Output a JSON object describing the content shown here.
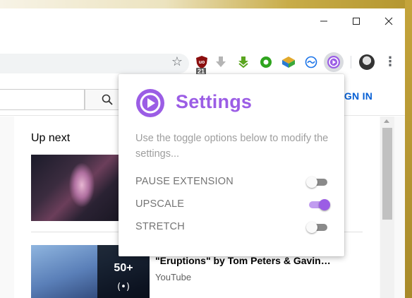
{
  "theme": {
    "accent": "#9b5de5",
    "accent_light": "#c19cf0",
    "link_blue": "#065fd4"
  },
  "window_controls": {
    "minimize_icon": "minimize-icon",
    "maximize_icon": "maximize-icon",
    "close_icon": "close-icon"
  },
  "toolbar": {
    "extensions": [
      {
        "icon": "ublock-icon",
        "badge": "21"
      },
      {
        "icon": "download-gray-icon"
      },
      {
        "icon": "download-green-icon"
      },
      {
        "icon": "green-circle-icon"
      },
      {
        "icon": "cube-icon"
      },
      {
        "icon": "sync-icon"
      },
      {
        "icon": "play-extension-icon"
      }
    ],
    "bookmark_icon": "star-icon",
    "menu_icon": "more-vert-icon"
  },
  "youtube": {
    "sign_in_label": "SIGN IN",
    "up_next_label": "Up next",
    "videos": [
      {
        "thumbnail": "anime-night-thumbnail"
      },
      {
        "thumbnail": "anime-sky-thumbnail",
        "playlist_count": "50+",
        "playlist_icon": "(•)",
        "title": "\"Eruptions\" by Tom Peters & Gavin…",
        "channel": "YouTube"
      }
    ]
  },
  "settings_popup": {
    "title": "Settings",
    "description": "Use the toggle options below to modify the settings...",
    "options": [
      {
        "label": "PAUSE EXTENSION",
        "enabled": false
      },
      {
        "label": "UPSCALE",
        "enabled": true
      },
      {
        "label": "STRETCH",
        "enabled": false
      }
    ]
  }
}
